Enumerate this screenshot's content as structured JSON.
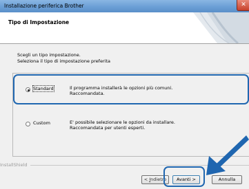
{
  "window": {
    "title": "Installazione periferica Brother",
    "close_glyph": "✕"
  },
  "header": {
    "title": "Tipo di Impostazione"
  },
  "intro": {
    "line1": "Scegli un tipo  impostazione.",
    "line2": "Seleziona il tipo di impostazione preferita"
  },
  "options": [
    {
      "label": "Standard",
      "selected": true,
      "desc1": "Il programma installerà le opzioni più comuni.",
      "desc2": "Raccomandata."
    },
    {
      "label": "Custom",
      "selected": false,
      "desc1": "E' possibile selezionare le opzioni da installare.",
      "desc2": "Raccomandata per utenti esperti."
    }
  ],
  "footer": {
    "brand": "InstallShield"
  },
  "buttons": {
    "back": {
      "prefix": "< ",
      "key": "I",
      "rest": "ndietro"
    },
    "next": {
      "label": "Avanti >"
    },
    "cancel": {
      "label": "Annulla"
    }
  },
  "colors": {
    "highlight": "#1f66b0",
    "title_bar": "#6b9fd6"
  }
}
